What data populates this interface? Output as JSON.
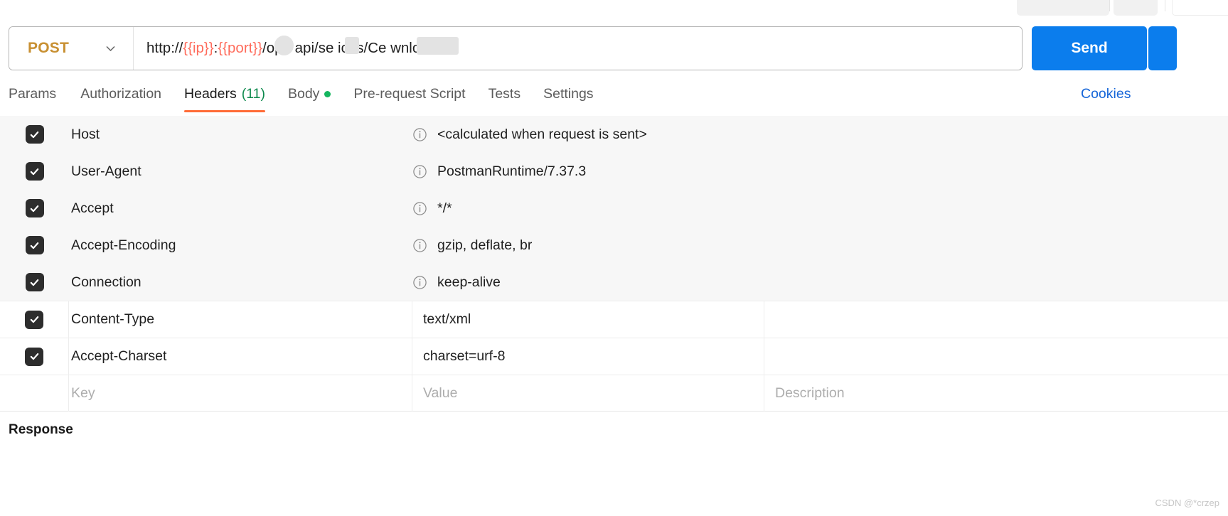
{
  "request_bar": {
    "method": "POST",
    "method_color": "#c89032",
    "chevron_icon": "chevron-down-icon",
    "url_prefix": "http://",
    "url_var_ip": "{{ip}}",
    "url_colon": ":",
    "url_var_port": "{{port}}",
    "url_suffix": "/ope api/se ices/Ce wnload",
    "url_full": "http://{{ip}}:{{port}}/ope api/se ices/Ce wnload",
    "send_label": "Send",
    "variable_color": "#ff6c5c",
    "send_color": "#0b7ded"
  },
  "tabs": {
    "active_indicator_color": "#ff6c37",
    "items": [
      {
        "label": "Params",
        "count": "",
        "dot": false,
        "active": false
      },
      {
        "label": "Authorization",
        "count": "",
        "dot": false,
        "active": false
      },
      {
        "label": "Headers",
        "count": "(11)",
        "dot": false,
        "active": true
      },
      {
        "label": "Body",
        "count": "",
        "dot": true,
        "active": false
      },
      {
        "label": "Pre-request Script",
        "count": "",
        "dot": false,
        "active": false
      },
      {
        "label": "Tests",
        "count": "",
        "dot": false,
        "active": false
      },
      {
        "label": "Settings",
        "count": "",
        "dot": false,
        "active": false
      }
    ],
    "cookies_label": "Cookies",
    "cookies_color": "#1565d8",
    "count_color": "#0e8a4e",
    "dot_color": "#15b65f"
  },
  "headers_table": {
    "columns": [
      "Key",
      "Value",
      "Description"
    ],
    "placeholder_key": "Key",
    "placeholder_value": "Value",
    "placeholder_description": "Description",
    "info_icon": "info-circle-icon",
    "check_icon": "checkmark-icon",
    "rows": [
      {
        "checked": true,
        "key": "Host",
        "value": "<calculated when request is sent>",
        "description": "",
        "auto": true
      },
      {
        "checked": true,
        "key": "User-Agent",
        "value": "PostmanRuntime/7.37.3",
        "description": "",
        "auto": true
      },
      {
        "checked": true,
        "key": "Accept",
        "value": "*/*",
        "description": "",
        "auto": true
      },
      {
        "checked": true,
        "key": "Accept-Encoding",
        "value": "gzip, deflate, br",
        "description": "",
        "auto": true
      },
      {
        "checked": true,
        "key": "Connection",
        "value": "keep-alive",
        "description": "",
        "auto": true
      },
      {
        "checked": true,
        "key": "Content-Type",
        "value": "text/xml",
        "description": "",
        "auto": false
      },
      {
        "checked": true,
        "key": "Accept-Charset",
        "value": "charset=urf-8",
        "description": "",
        "auto": false
      }
    ]
  },
  "response": {
    "title": "Response"
  },
  "watermark": {
    "text": "CSDN @*crzep"
  }
}
